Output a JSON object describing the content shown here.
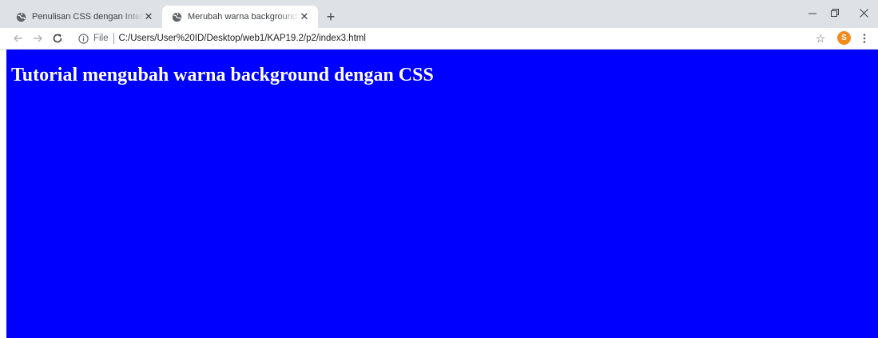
{
  "tabs": [
    {
      "title": "Penulisan CSS dengan Internal Style",
      "active": false
    },
    {
      "title": "Merubah warna background dengan CSS",
      "active": true
    }
  ],
  "toolbar": {
    "file_label": "File",
    "url": "C:/Users/User%20ID/Desktop/web1/KAP19.2/p2/index3.html",
    "avatar_letter": "S"
  },
  "page": {
    "heading": "Tutorial mengubah warna background dengan CSS",
    "background_color": "#0000ff",
    "heading_color": "#ffffff"
  },
  "colors": {
    "tabstrip": "#dee1e6",
    "avatar": "#f28b1e"
  }
}
